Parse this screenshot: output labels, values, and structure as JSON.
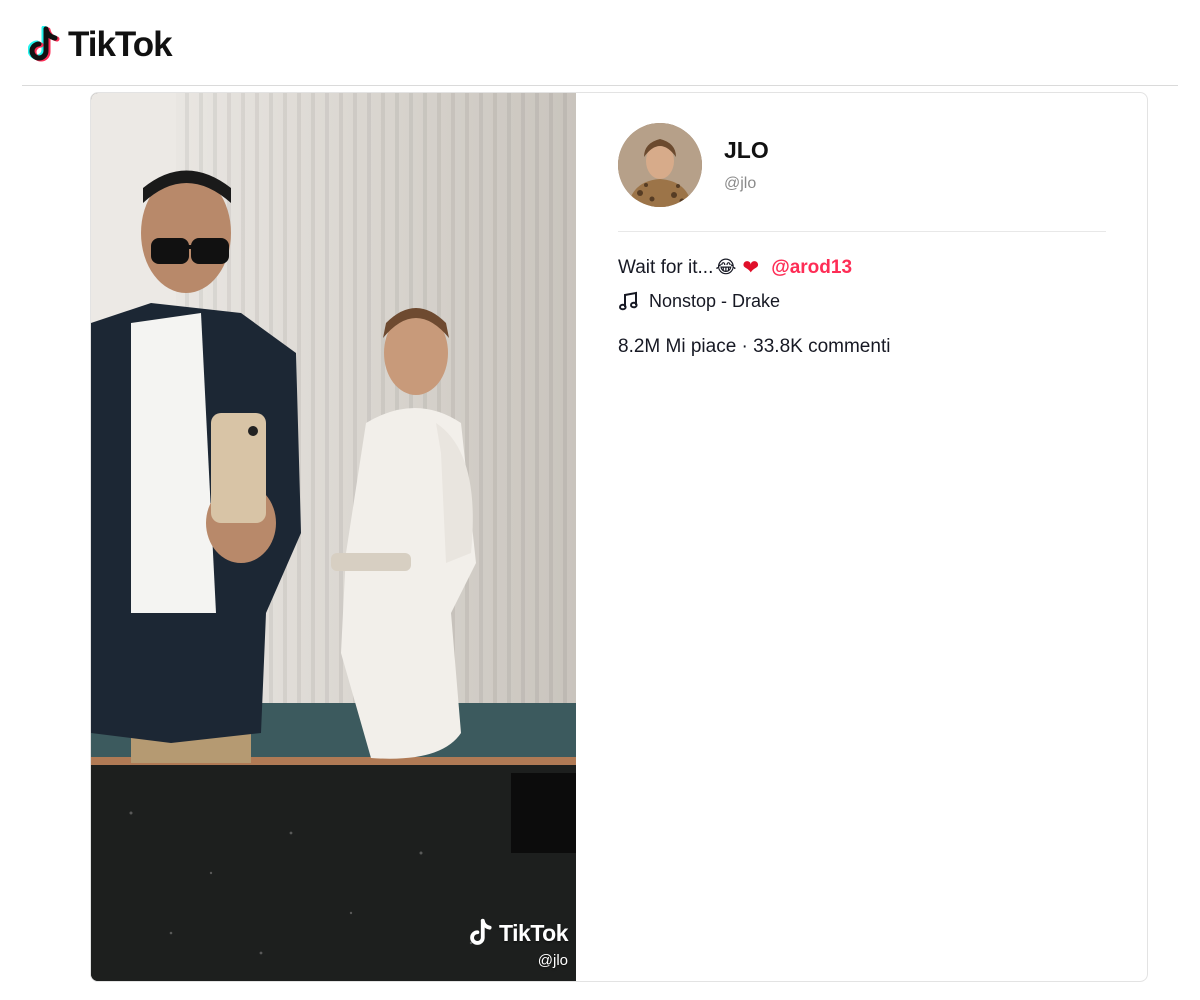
{
  "header": {
    "brand": "TikTok"
  },
  "post": {
    "display_name": "JLO",
    "username": "@jlo",
    "caption_text": "Wait for it...",
    "caption_emoji": "😂",
    "caption_heart": "❤",
    "mention": "@arod13",
    "music": "Nonstop - Drake",
    "stats": "8.2M Mi piace · 33.8K commenti"
  },
  "video": {
    "watermark_brand": "TikTok",
    "watermark_handle": "@jlo"
  },
  "colors": {
    "mention": "#fe2c55",
    "tiktok_cyan": "#25f4ee",
    "tiktok_red": "#fe2c55"
  },
  "icons": {
    "logo": "tiktok-note-icon",
    "music": "music-note-icon"
  }
}
